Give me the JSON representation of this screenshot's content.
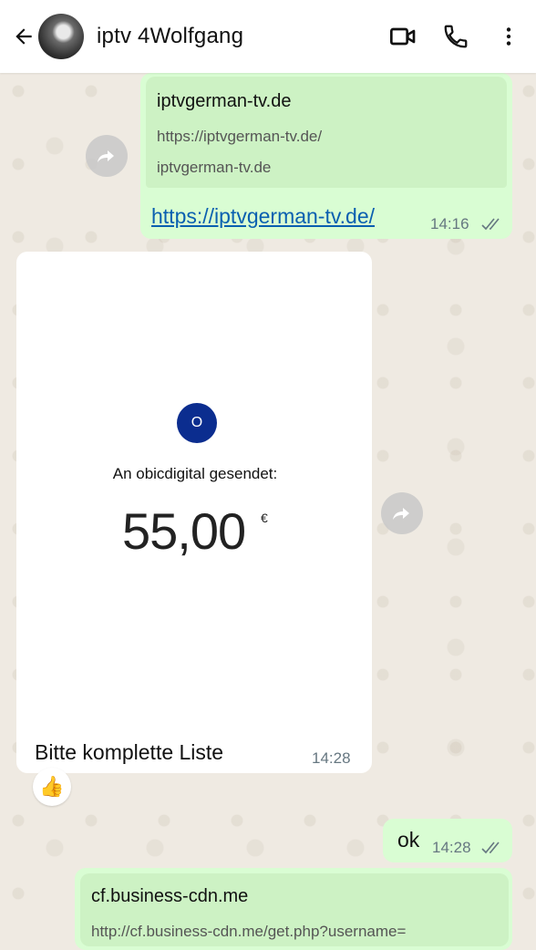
{
  "header": {
    "contact_name": "iptv 4Wolfgang",
    "icons": [
      "back-arrow-icon",
      "video-call-icon",
      "phone-icon",
      "more-vert-icon"
    ]
  },
  "messages": {
    "link_preview": {
      "title": "iptvgerman-tv.de",
      "description": "https://iptvgerman-tv.de/",
      "domain": "iptvgerman-tv.de"
    },
    "link_text": "https://iptvgerman-tv.de/",
    "link_time": "14:16",
    "payment": {
      "logo_letter": "O",
      "sent_text": "An obicdigital gesendet:",
      "amount": "55,00",
      "currency": "€"
    },
    "caption": "Bitte komplette Liste",
    "caption_time": "14:28",
    "reaction_emoji": "👍",
    "ok_text": "ok",
    "ok_time": "14:28",
    "link_preview2": {
      "title": "cf.business-cdn.me",
      "description": "http://cf.business-cdn.me/get.php?username="
    }
  },
  "colors": {
    "outgoing_bubble": "#d9fdd3",
    "incoming_bubble": "#ffffff",
    "chat_background": "#efeae2",
    "link": "#0a5fb0"
  }
}
